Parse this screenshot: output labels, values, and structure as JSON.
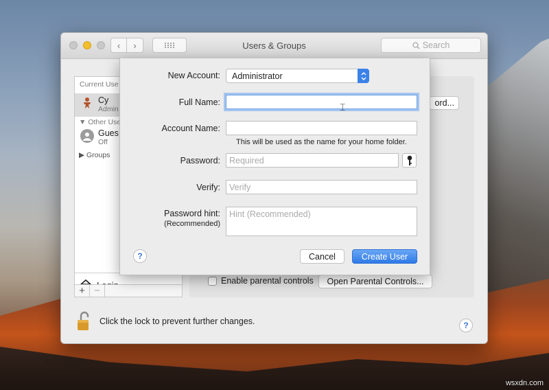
{
  "window": {
    "title": "Users & Groups",
    "search_placeholder": "Search"
  },
  "sidebar": {
    "current_users_header": "Current Use",
    "current_user": {
      "name": "Cy",
      "role": "Admin"
    },
    "other_users_header": "Other Use",
    "guest": {
      "name": "Gues",
      "status": "Off"
    },
    "groups_label": "Groups",
    "login_label": "Login",
    "add_label": "+",
    "remove_label": "−"
  },
  "main": {
    "change_password_partial": "ord...",
    "enable_parental_label": "Enable parental controls",
    "open_parental_label": "Open Parental Controls...",
    "lock_text": "Click the lock to prevent further changes.",
    "help_label": "?"
  },
  "sheet": {
    "new_account_label": "New Account:",
    "new_account_value": "Administrator",
    "full_name_label": "Full Name:",
    "full_name_value": "",
    "account_name_label": "Account Name:",
    "account_name_value": "",
    "home_folder_note": "This will be used as the name for your home folder.",
    "password_label": "Password:",
    "password_placeholder": "Required",
    "verify_label": "Verify:",
    "verify_placeholder": "Verify",
    "hint_label": "Password hint:",
    "hint_sublabel": "(Recommended)",
    "hint_placeholder": "Hint (Recommended)",
    "cancel_label": "Cancel",
    "create_label": "Create User",
    "help_label": "?"
  },
  "watermark": "wsxdn.com",
  "colors": {
    "accent": "#3b82e8",
    "lock": "#d99a2b"
  }
}
